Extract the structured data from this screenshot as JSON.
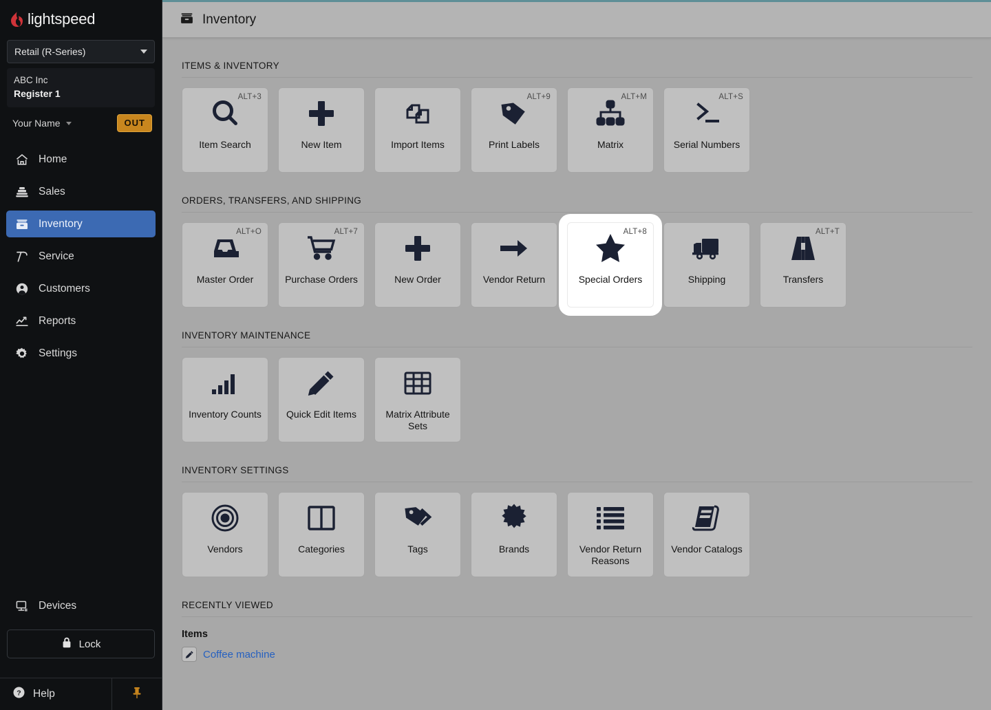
{
  "sidebar": {
    "brand": "lightspeed",
    "brand_icon": "lightspeed-flame-logo",
    "series_selector": {
      "value": "Retail (R-Series)",
      "icon": "chevron-down-icon"
    },
    "register": {
      "company": "ABC Inc",
      "register": "Register 1"
    },
    "user": {
      "name": "Your Name",
      "status_badge": "OUT",
      "badge_color": "#c8861e",
      "caret_icon": "chevron-down-icon"
    },
    "nav": [
      {
        "label": "Home",
        "icon": "home-icon",
        "active": false
      },
      {
        "label": "Sales",
        "icon": "cash-register-icon",
        "active": false
      },
      {
        "label": "Inventory",
        "icon": "inventory-box-icon",
        "active": true
      },
      {
        "label": "Service",
        "icon": "hammer-icon",
        "active": false
      },
      {
        "label": "Customers",
        "icon": "person-circle-icon",
        "active": false
      },
      {
        "label": "Reports",
        "icon": "line-chart-icon",
        "active": false
      },
      {
        "label": "Settings",
        "icon": "gear-icon",
        "active": false
      }
    ],
    "devices": {
      "label": "Devices",
      "icon": "monitor-icon"
    },
    "lock": {
      "label": "Lock",
      "icon": "lock-icon"
    },
    "help": {
      "label": "Help",
      "icon": "question-circle-icon"
    },
    "pin": {
      "icon": "pushpin-icon",
      "color": "#c8861e"
    },
    "active_color": "#3c6ab3"
  },
  "topbar": {
    "title": "Inventory",
    "icon": "inventory-box-icon"
  },
  "sections": [
    {
      "heading": "ITEMS & INVENTORY",
      "tiles": [
        {
          "label": "Item Search",
          "shortcut": "ALT+3",
          "icon": "magnifier-icon",
          "selected": false
        },
        {
          "label": "New Item",
          "shortcut": "",
          "icon": "plus-icon",
          "selected": false
        },
        {
          "label": "Import Items",
          "shortcut": "",
          "icon": "copy-pages-icon",
          "selected": false
        },
        {
          "label": "Print Labels",
          "shortcut": "ALT+9",
          "icon": "price-tag-icon",
          "selected": false
        },
        {
          "label": "Matrix",
          "shortcut": "ALT+M",
          "icon": "org-chart-icon",
          "selected": false
        },
        {
          "label": "Serial Numbers",
          "shortcut": "ALT+S",
          "icon": "terminal-icon",
          "selected": false
        }
      ]
    },
    {
      "heading": "ORDERS, TRANSFERS, AND SHIPPING",
      "tiles": [
        {
          "label": "Master Order",
          "shortcut": "ALT+O",
          "icon": "inbox-tray-icon",
          "selected": false
        },
        {
          "label": "Purchase Orders",
          "shortcut": "ALT+7",
          "icon": "shopping-cart-icon",
          "selected": false
        },
        {
          "label": "New Order",
          "shortcut": "",
          "icon": "plus-icon",
          "selected": false
        },
        {
          "label": "Vendor Return",
          "shortcut": "",
          "icon": "arrow-right-icon",
          "selected": false
        },
        {
          "label": "Special Orders",
          "shortcut": "ALT+8",
          "icon": "star-icon",
          "selected": true
        },
        {
          "label": "Shipping",
          "shortcut": "",
          "icon": "delivery-truck-icon",
          "selected": false
        },
        {
          "label": "Transfers",
          "shortcut": "ALT+T",
          "icon": "road-icon",
          "selected": false
        }
      ]
    },
    {
      "heading": "INVENTORY MAINTENANCE",
      "tiles": [
        {
          "label": "Inventory Counts",
          "shortcut": "",
          "icon": "bar-chart-icon",
          "selected": false
        },
        {
          "label": "Quick Edit Items",
          "shortcut": "",
          "icon": "pencil-icon",
          "selected": false
        },
        {
          "label": "Matrix Attribute Sets",
          "shortcut": "",
          "icon": "grid-table-icon",
          "selected": false
        }
      ]
    },
    {
      "heading": "INVENTORY SETTINGS",
      "tiles": [
        {
          "label": "Vendors",
          "shortcut": "",
          "icon": "target-rings-icon",
          "selected": false
        },
        {
          "label": "Categories",
          "shortcut": "",
          "icon": "two-columns-icon",
          "selected": false
        },
        {
          "label": "Tags",
          "shortcut": "",
          "icon": "tags-icon",
          "selected": false
        },
        {
          "label": "Brands",
          "shortcut": "",
          "icon": "burst-badge-icon",
          "selected": false
        },
        {
          "label": "Vendor Return Reasons",
          "shortcut": "",
          "icon": "bullet-list-icon",
          "selected": false
        },
        {
          "label": "Vendor Catalogs",
          "shortcut": "",
          "icon": "book-icon",
          "selected": false
        }
      ]
    }
  ],
  "recently_viewed": {
    "heading": "RECENTLY VIEWED",
    "subheading": "Items",
    "items": [
      {
        "label": "Coffee machine",
        "icon": "pencil-icon",
        "link_color": "#2560c0"
      }
    ]
  }
}
